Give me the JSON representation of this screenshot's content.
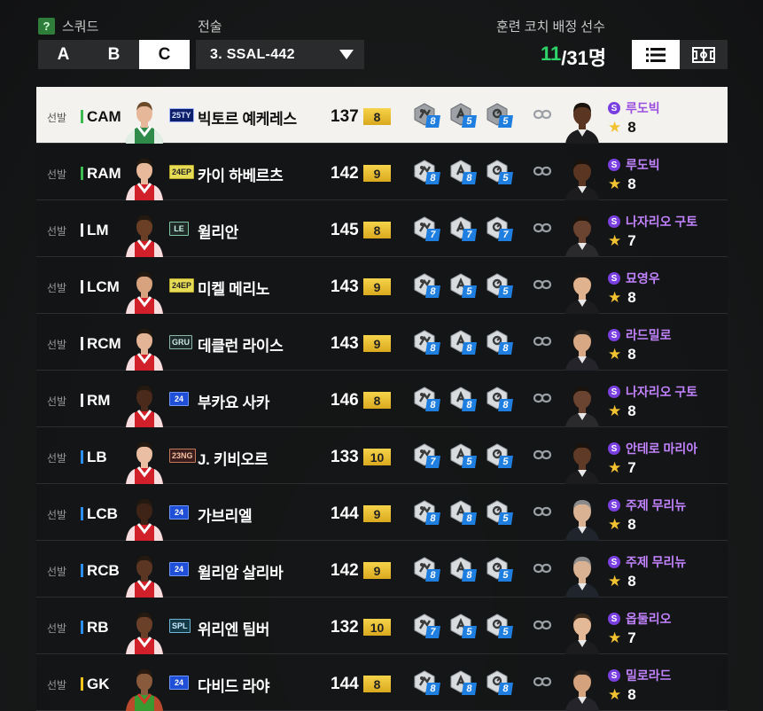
{
  "header": {
    "squad_label": "스쿼드",
    "help_icon": "?",
    "squad_tabs": [
      "A",
      "B",
      "C"
    ],
    "selected_squad": "C",
    "tactic_label": "전술",
    "tactic_value": "3. SSAL-442",
    "coach_title": "훈련 코치 배정 선수",
    "count_current": "11",
    "count_total": "/31명",
    "view_modes": [
      "list-icon",
      "formation-icon"
    ],
    "selected_view": "list-icon"
  },
  "colors": {
    "attack": "#3dba4f",
    "midfield": "#e8e8e8",
    "defense": "#2b8ef0",
    "goalkeeper": "#f0c419",
    "coach_name": "#c283ff",
    "trait_level": "#1f7fe0",
    "count_current": "#2ed36a"
  },
  "players": [
    {
      "status": "선발",
      "position": "CAM",
      "season": "25TY",
      "name": "빅토르 예케레스",
      "ovr": "137",
      "grade": "8",
      "traits": [
        "8",
        "5",
        "5"
      ],
      "coach_name": "루도빅",
      "coach_level": "8",
      "selected": true
    },
    {
      "status": "선발",
      "position": "RAM",
      "season": "24EP",
      "name": "카이 하베르츠",
      "ovr": "142",
      "grade": "9",
      "traits": [
        "8",
        "8",
        "5"
      ],
      "coach_name": "루도빅",
      "coach_level": "8",
      "selected": false
    },
    {
      "status": "선발",
      "position": "LM",
      "season": "LE",
      "name": "윌리안",
      "ovr": "145",
      "grade": "8",
      "traits": [
        "7",
        "7",
        "7"
      ],
      "coach_name": "나자리오 구토",
      "coach_level": "7",
      "selected": false
    },
    {
      "status": "선발",
      "position": "LCM",
      "season": "24EP",
      "name": "미켈 메리노",
      "ovr": "143",
      "grade": "9",
      "traits": [
        "8",
        "5",
        "5"
      ],
      "coach_name": "묘영우",
      "coach_level": "8",
      "selected": false
    },
    {
      "status": "선발",
      "position": "RCM",
      "season": "GRU",
      "name": "데클런 라이스",
      "ovr": "143",
      "grade": "9",
      "traits": [
        "8",
        "8",
        "8"
      ],
      "coach_name": "라드밀로",
      "coach_level": "8",
      "selected": false
    },
    {
      "status": "선발",
      "position": "RM",
      "season": "24",
      "name": "부카요 사카",
      "ovr": "146",
      "grade": "8",
      "traits": [
        "8",
        "8",
        "8"
      ],
      "coach_name": "나자리오 구토",
      "coach_level": "8",
      "selected": false
    },
    {
      "status": "선발",
      "position": "LB",
      "season": "23NG",
      "name": "J. 키비오르",
      "ovr": "133",
      "grade": "10",
      "traits": [
        "7",
        "5",
        "5"
      ],
      "coach_name": "안테로 마리아",
      "coach_level": "7",
      "selected": false
    },
    {
      "status": "선발",
      "position": "LCB",
      "season": "24",
      "name": "가브리엘",
      "ovr": "144",
      "grade": "9",
      "traits": [
        "8",
        "8",
        "5"
      ],
      "coach_name": "주제 무리뉴",
      "coach_level": "8",
      "selected": false
    },
    {
      "status": "선발",
      "position": "RCB",
      "season": "24",
      "name": "윌리암 살리바",
      "ovr": "142",
      "grade": "9",
      "traits": [
        "8",
        "8",
        "5"
      ],
      "coach_name": "주제 무리뉴",
      "coach_level": "8",
      "selected": false
    },
    {
      "status": "선발",
      "position": "RB",
      "season": "SPL",
      "name": "위리엔 팀버",
      "ovr": "132",
      "grade": "10",
      "traits": [
        "7",
        "5",
        "5"
      ],
      "coach_name": "옵둘리오",
      "coach_level": "7",
      "selected": false
    },
    {
      "status": "선발",
      "position": "GK",
      "season": "24",
      "name": "다비드 라야",
      "ovr": "144",
      "grade": "8",
      "traits": [
        "8",
        "8",
        "8"
      ],
      "coach_name": "밀로라드",
      "coach_level": "8",
      "selected": false
    }
  ]
}
